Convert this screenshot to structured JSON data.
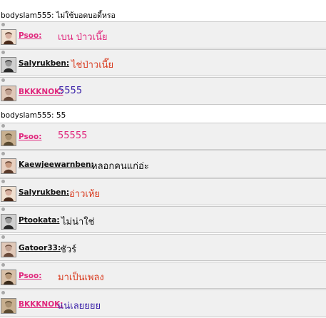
{
  "colors": {
    "row_bg": "#f0f0f0",
    "row_border": "#c8c8c8",
    "bullet": "#a8a8a8",
    "pink": "#e0287d",
    "red": "#d93b1f",
    "purple": "#3a21a8",
    "dark": "#111111"
  },
  "messages": [
    {
      "kind": "system",
      "text": "bodyslam555: ไม่ใช้บอดบอดี้หรอ"
    },
    {
      "kind": "chat",
      "avatar": "avatar-icon",
      "name": "Psoo:",
      "name_color": "#e0287d",
      "text": "เบน ป่าวเนี๊ย",
      "text_color": "#e0287d"
    },
    {
      "kind": "chat",
      "avatar": "avatar-icon",
      "name": "Salyrukben:",
      "name_color": "#111111",
      "text": "ไช่ป่าวเนี๊ย",
      "text_color": "#d93b1f"
    },
    {
      "kind": "chat",
      "avatar": "avatar-icon",
      "name": "BKKKNOK:",
      "name_color": "#e0287d",
      "text": "5555",
      "text_color": "#3a21a8"
    },
    {
      "kind": "system",
      "text": "bodyslam555: 55"
    },
    {
      "kind": "chat",
      "avatar": "avatar-icon",
      "name": "Psoo:",
      "name_color": "#e0287d",
      "text": "55555",
      "text_color": "#e0287d"
    },
    {
      "kind": "chat",
      "avatar": "avatar-icon",
      "name": "Kaewjeewarnben:",
      "name_color": "#111111",
      "text": "หลอกคนแก่อ่ะ",
      "text_color": "#111111"
    },
    {
      "kind": "chat",
      "avatar": "avatar-icon",
      "name": "Salyrukben:",
      "name_color": "#111111",
      "text": "อ่าวเห้ย",
      "text_color": "#d93b1f"
    },
    {
      "kind": "chat",
      "avatar": "avatar-icon",
      "name": "Ptookata:",
      "name_color": "#111111",
      "text": "ไม่น่าใช่",
      "text_color": "#111111"
    },
    {
      "kind": "chat",
      "avatar": "avatar-icon",
      "name": "Gatoor33:",
      "name_color": "#111111",
      "text": "ชัวร์",
      "text_color": "#111111"
    },
    {
      "kind": "chat",
      "avatar": "avatar-icon",
      "name": "Psoo:",
      "name_color": "#e0287d",
      "text": "มาเป็นเพลง",
      "text_color": "#d93b1f"
    },
    {
      "kind": "chat",
      "avatar": "avatar-icon",
      "name": "BKKKNOK:",
      "name_color": "#e0287d",
      "text": "แน่เลยยยย",
      "text_color": "#3a21a8"
    }
  ]
}
